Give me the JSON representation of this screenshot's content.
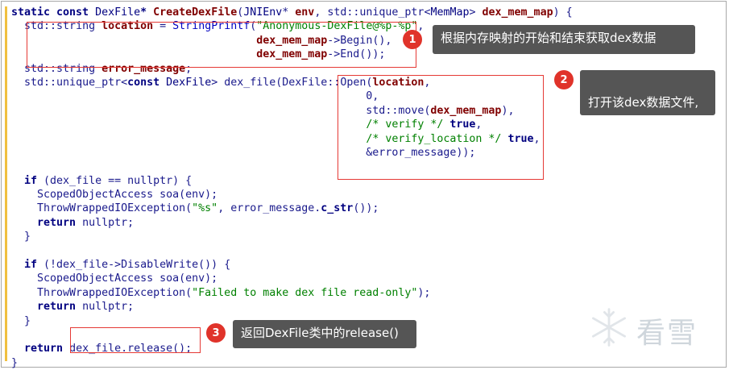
{
  "code_lines": [
    [
      {
        "t": "static const ",
        "c": "kw"
      },
      {
        "t": "DexFile",
        "c": "ty"
      },
      {
        "t": "* ",
        "c": "kw"
      },
      {
        "t": "CreateDexFile",
        "c": "fn"
      },
      {
        "t": "(",
        "c": ""
      },
      {
        "t": "JNIEnv",
        "c": "ty"
      },
      {
        "t": "* ",
        "c": ""
      },
      {
        "t": "env",
        "c": "pm"
      },
      {
        "t": ", std::",
        "c": ""
      },
      {
        "t": "unique_ptr",
        "c": ""
      },
      {
        "t": "<",
        "c": ""
      },
      {
        "t": "MemMap",
        "c": "ty"
      },
      {
        "t": "> ",
        "c": ""
      },
      {
        "t": "dex_mem_map",
        "c": "pm"
      },
      {
        "t": ") {",
        "c": ""
      }
    ],
    [
      {
        "t": "  std::",
        "c": ""
      },
      {
        "t": "string ",
        "c": ""
      },
      {
        "t": "location",
        "c": "pm"
      },
      {
        "t": " = ",
        "c": ""
      },
      {
        "t": "StringPrintf",
        "c": "fc"
      },
      {
        "t": "(",
        "c": ""
      },
      {
        "t": "\"Anonymous-DexFile@%p-%p\"",
        "c": "st"
      },
      {
        "t": ",",
        "c": ""
      }
    ],
    [
      {
        "t": "                                      ",
        "c": ""
      },
      {
        "t": "dex_mem_map",
        "c": "pm"
      },
      {
        "t": "->Begin(),",
        "c": ""
      }
    ],
    [
      {
        "t": "                                      ",
        "c": ""
      },
      {
        "t": "dex_mem_map",
        "c": "pm"
      },
      {
        "t": "->End());",
        "c": ""
      }
    ],
    [
      {
        "t": "  std::",
        "c": ""
      },
      {
        "t": "string ",
        "c": ""
      },
      {
        "t": "error_message",
        "c": "pm"
      },
      {
        "t": ";",
        "c": ""
      }
    ],
    [
      {
        "t": "  std::",
        "c": ""
      },
      {
        "t": "unique_ptr",
        "c": ""
      },
      {
        "t": "<",
        "c": ""
      },
      {
        "t": "const ",
        "c": "kw"
      },
      {
        "t": "DexFile",
        "c": "ty"
      },
      {
        "t": "> dex_file(DexFile::",
        "c": ""
      },
      {
        "t": "Open",
        "c": ""
      },
      {
        "t": "(",
        "c": ""
      },
      {
        "t": "location",
        "c": "pm"
      },
      {
        "t": ",",
        "c": ""
      }
    ],
    [
      {
        "t": "                                                       0,",
        "c": ""
      }
    ],
    [
      {
        "t": "                                                       std::",
        "c": ""
      },
      {
        "t": "move",
        "c": ""
      },
      {
        "t": "(",
        "c": ""
      },
      {
        "t": "dex_mem_map",
        "c": "pm"
      },
      {
        "t": "),",
        "c": ""
      }
    ],
    [
      {
        "t": "                                                       ",
        "c": ""
      },
      {
        "t": "/* verify */ ",
        "c": "cm"
      },
      {
        "t": "true",
        "c": "kw"
      },
      {
        "t": ",",
        "c": ""
      }
    ],
    [
      {
        "t": "                                                       ",
        "c": ""
      },
      {
        "t": "/* verify_location */ ",
        "c": "cm"
      },
      {
        "t": "true",
        "c": "kw"
      },
      {
        "t": ",",
        "c": ""
      }
    ],
    [
      {
        "t": "                                                       &error_message));",
        "c": ""
      }
    ],
    [
      {
        "t": "",
        "c": ""
      }
    ],
    [
      {
        "t": "  ",
        "c": ""
      },
      {
        "t": "if",
        "c": "kw"
      },
      {
        "t": " (dex_file == nullptr) {",
        "c": ""
      }
    ],
    [
      {
        "t": "    ScopedObjectAccess soa(env);",
        "c": ""
      }
    ],
    [
      {
        "t": "    ThrowWrappedIOException(",
        "c": ""
      },
      {
        "t": "\"%s\"",
        "c": "st"
      },
      {
        "t": ", error_message.",
        "c": ""
      },
      {
        "t": "c_str",
        "c": "kw"
      },
      {
        "t": "());",
        "c": ""
      }
    ],
    [
      {
        "t": "    ",
        "c": ""
      },
      {
        "t": "return",
        "c": "kw"
      },
      {
        "t": " nullptr;",
        "c": ""
      }
    ],
    [
      {
        "t": "  }",
        "c": ""
      }
    ],
    [
      {
        "t": "",
        "c": ""
      }
    ],
    [
      {
        "t": "  ",
        "c": ""
      },
      {
        "t": "if",
        "c": "kw"
      },
      {
        "t": " (!dex_file->DisableWrite()) {",
        "c": ""
      }
    ],
    [
      {
        "t": "    ScopedObjectAccess soa(env);",
        "c": ""
      }
    ],
    [
      {
        "t": "    ThrowWrappedIOException(",
        "c": ""
      },
      {
        "t": "\"Failed to make dex file read-only\"",
        "c": "st"
      },
      {
        "t": ");",
        "c": ""
      }
    ],
    [
      {
        "t": "    ",
        "c": ""
      },
      {
        "t": "return",
        "c": "kw"
      },
      {
        "t": " nullptr;",
        "c": ""
      }
    ],
    [
      {
        "t": "  }",
        "c": ""
      }
    ],
    [
      {
        "t": "",
        "c": ""
      }
    ],
    [
      {
        "t": "  ",
        "c": ""
      },
      {
        "t": "return",
        "c": "kw"
      },
      {
        "t": " dex_file.release();",
        "c": ""
      }
    ],
    [
      {
        "t": "}",
        "c": ""
      }
    ]
  ],
  "annotations": [
    {
      "number": "1",
      "text": "根据内存映射的开始和结束获取dex数据"
    },
    {
      "number": "2",
      "text": "打开该dex数据文件,\n创建DexFile对象"
    },
    {
      "number": "3",
      "text": "返回DexFile类中的release()"
    }
  ],
  "watermark": {
    "text": "看雪",
    "icon": "snowflake-icon"
  }
}
